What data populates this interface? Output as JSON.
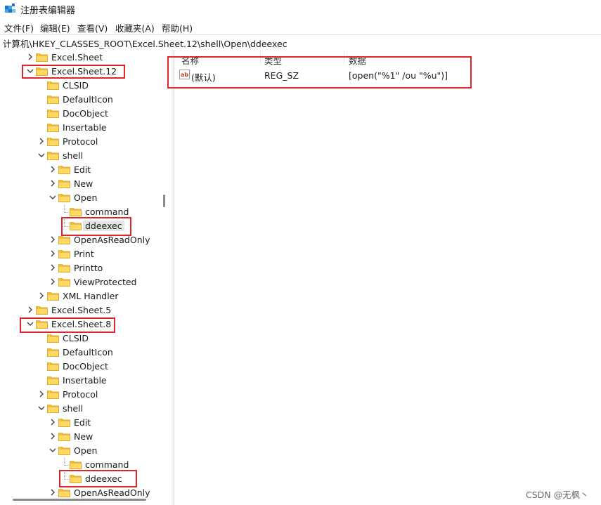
{
  "window": {
    "title": "注册表编辑器"
  },
  "menu": [
    "文件(F)",
    "编辑(E)",
    "查看(V)",
    "收藏夹(A)",
    "帮助(H)"
  ],
  "address": "计算机\\HKEY_CLASSES_ROOT\\Excel.Sheet.12\\shell\\Open\\ddeexec",
  "tree": [
    {
      "label": "Excel.Sheet",
      "depth": 0,
      "chevron": "right"
    },
    {
      "label": "Excel.Sheet.12",
      "depth": 0,
      "chevron": "down"
    },
    {
      "label": "CLSID",
      "depth": 1,
      "chevron": ""
    },
    {
      "label": "DefaultIcon",
      "depth": 1,
      "chevron": ""
    },
    {
      "label": "DocObject",
      "depth": 1,
      "chevron": ""
    },
    {
      "label": "Insertable",
      "depth": 1,
      "chevron": ""
    },
    {
      "label": "Protocol",
      "depth": 1,
      "chevron": "right"
    },
    {
      "label": "shell",
      "depth": 1,
      "chevron": "down"
    },
    {
      "label": "Edit",
      "depth": 2,
      "chevron": "right"
    },
    {
      "label": "New",
      "depth": 2,
      "chevron": "right"
    },
    {
      "label": "Open",
      "depth": 2,
      "chevron": "down"
    },
    {
      "label": "command",
      "depth": 3,
      "chevron": ""
    },
    {
      "label": "ddeexec",
      "depth": 3,
      "chevron": "",
      "selected": true
    },
    {
      "label": "OpenAsReadOnly",
      "depth": 2,
      "chevron": "right"
    },
    {
      "label": "Print",
      "depth": 2,
      "chevron": "right"
    },
    {
      "label": "Printto",
      "depth": 2,
      "chevron": "right"
    },
    {
      "label": "ViewProtected",
      "depth": 2,
      "chevron": "right"
    },
    {
      "label": "XML Handler",
      "depth": 1,
      "chevron": "right"
    },
    {
      "label": "Excel.Sheet.5",
      "depth": 0,
      "chevron": "right"
    },
    {
      "label": "Excel.Sheet.8",
      "depth": 0,
      "chevron": "down"
    },
    {
      "label": "CLSID",
      "depth": 1,
      "chevron": ""
    },
    {
      "label": "DefaultIcon",
      "depth": 1,
      "chevron": ""
    },
    {
      "label": "DocObject",
      "depth": 1,
      "chevron": ""
    },
    {
      "label": "Insertable",
      "depth": 1,
      "chevron": ""
    },
    {
      "label": "Protocol",
      "depth": 1,
      "chevron": "right"
    },
    {
      "label": "shell",
      "depth": 1,
      "chevron": "down"
    },
    {
      "label": "Edit",
      "depth": 2,
      "chevron": "right"
    },
    {
      "label": "New",
      "depth": 2,
      "chevron": "right"
    },
    {
      "label": "Open",
      "depth": 2,
      "chevron": "down"
    },
    {
      "label": "command",
      "depth": 3,
      "chevron": ""
    },
    {
      "label": "ddeexec",
      "depth": 3,
      "chevron": ""
    },
    {
      "label": "OpenAsReadOnly",
      "depth": 2,
      "chevron": "right"
    }
  ],
  "list": {
    "columns": [
      "名称",
      "类型",
      "数据"
    ],
    "rows": [
      {
        "name": "(默认)",
        "type": "REG_SZ",
        "data": "[open(\"%1\" /ou \"%u\")]"
      }
    ]
  },
  "icons": {
    "app": "regedit-icon",
    "folder": "folder-icon",
    "string_value": "ab-string-icon"
  },
  "colors": {
    "highlight_box": "#e0262d",
    "folder": "#f4c542",
    "selection": "#e5e5e5"
  },
  "watermark": "CSDN @无枫丶"
}
